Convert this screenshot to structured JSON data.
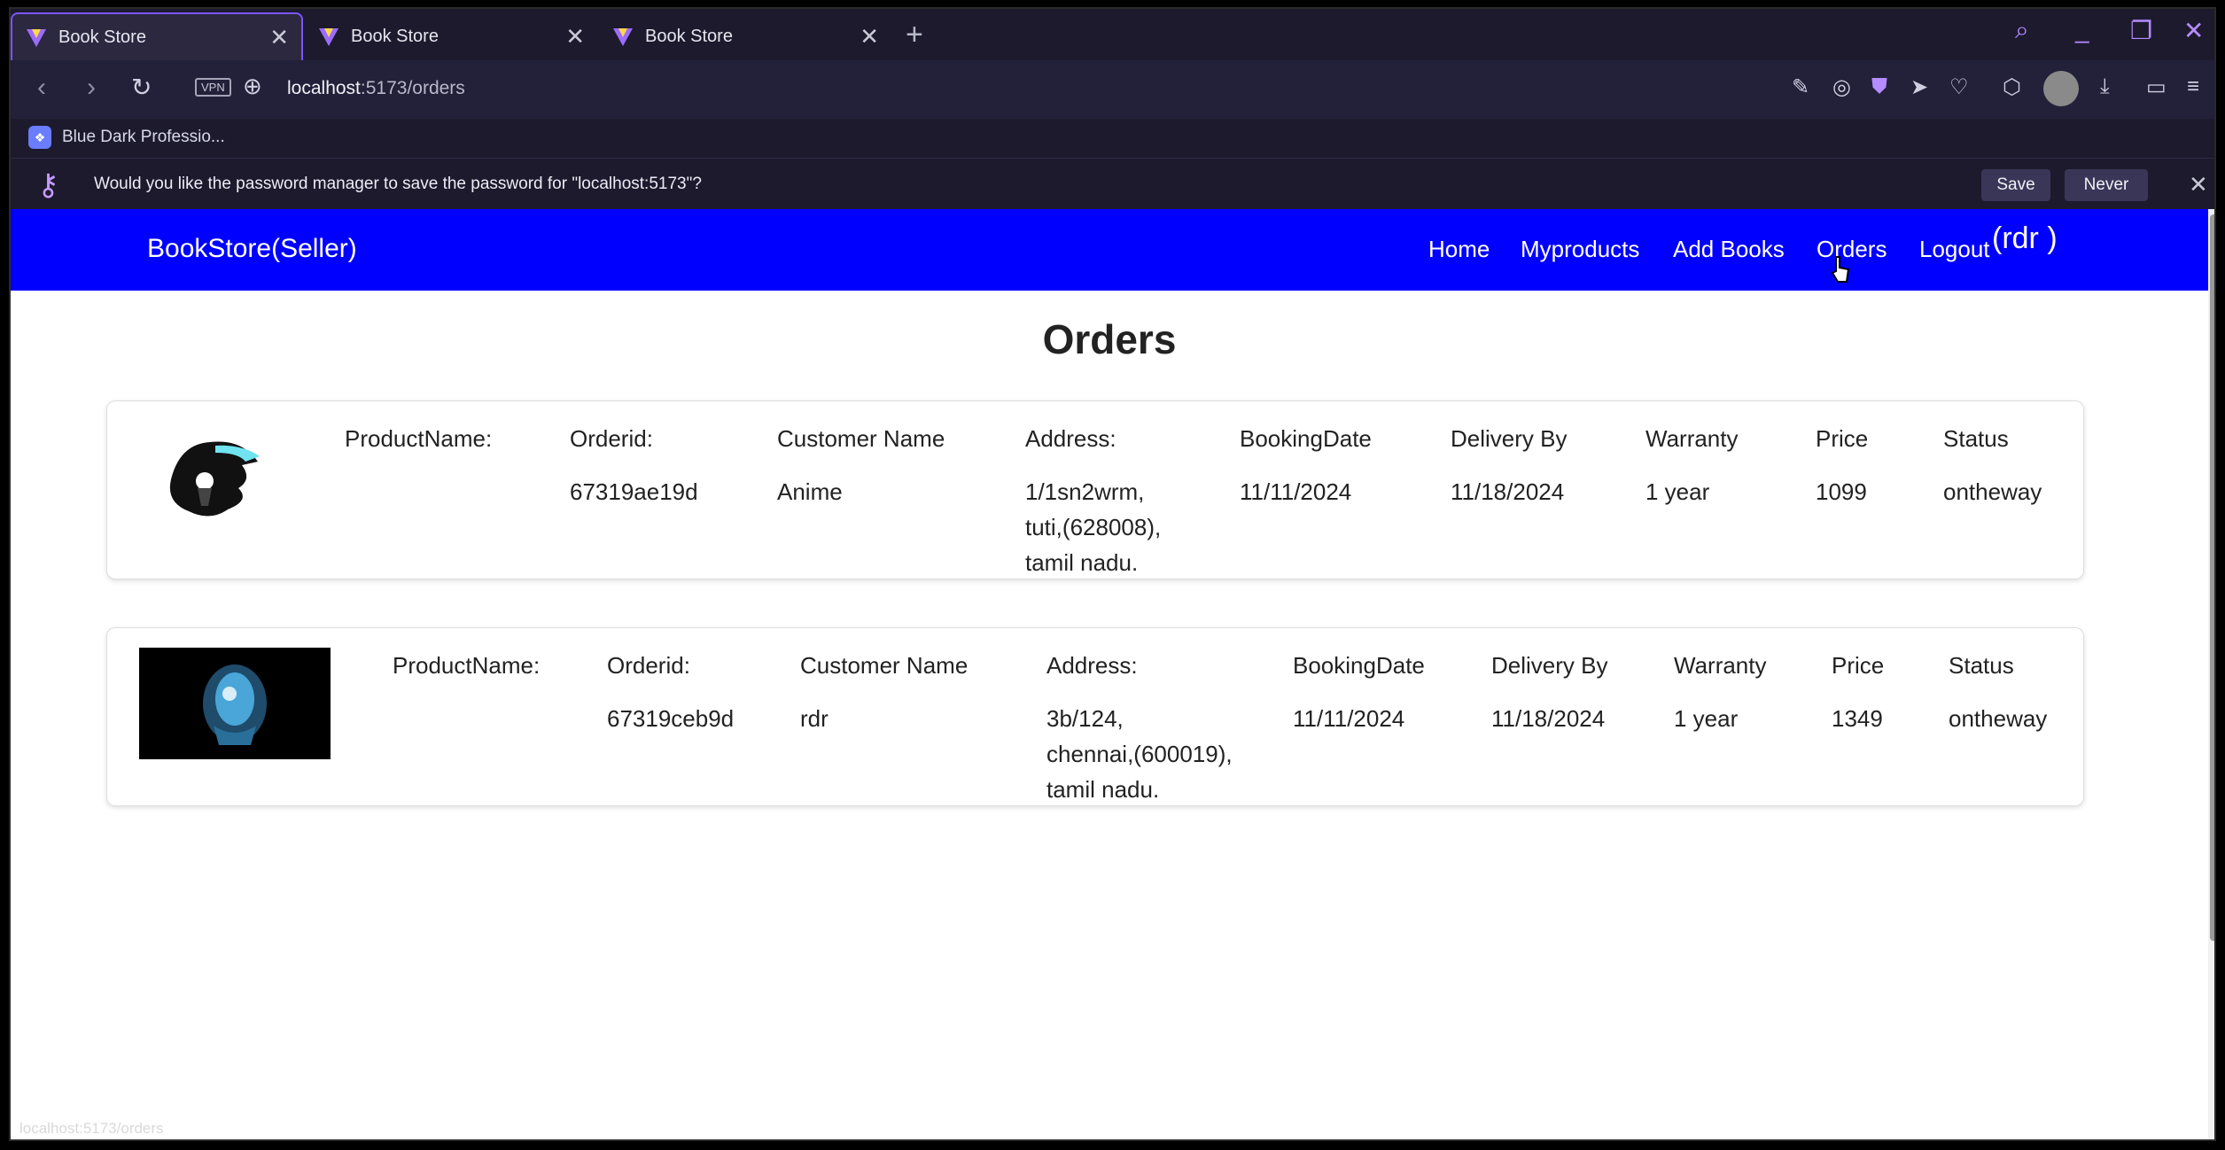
{
  "browser": {
    "tabs": [
      {
        "title": "Book Store",
        "active": true
      },
      {
        "title": "Book Store",
        "active": false
      },
      {
        "title": "Book Store",
        "active": false
      }
    ],
    "new_tab": "+",
    "address": {
      "host": "localhost",
      "rest": ":5173/orders"
    },
    "vpn_label": "VPN",
    "bookmark": "Blue Dark Professio...",
    "password_prompt": {
      "text": "Would you like the password manager to save the password for \"localhost:5173\"?",
      "save_label": "Save",
      "never_label": "Never"
    },
    "status_url": "localhost:5173/orders"
  },
  "navbar": {
    "brand": "BookStore(Seller)",
    "links": [
      "Home",
      "Myproducts",
      "Add Books",
      "Orders",
      "Logout"
    ],
    "user": "(rdr )"
  },
  "page": {
    "title": "Orders",
    "headers": {
      "product": "ProductName:",
      "orderid": "Orderid:",
      "customer": "Customer Name",
      "address": "Address:",
      "booking": "BookingDate",
      "delivery": "Delivery By",
      "warranty": "Warranty",
      "price": "Price",
      "status": "Status"
    },
    "orders": [
      {
        "orderid": "67319ae19d",
        "customer": "Anime",
        "address": [
          "1/1sn2wrm,",
          "tuti,(628008),",
          "tamil nadu."
        ],
        "booking": "11/11/2024",
        "delivery": "11/18/2024",
        "warranty": "1 year",
        "price": "1099",
        "status": "ontheway"
      },
      {
        "orderid": "67319ceb9d",
        "customer": "rdr",
        "address": [
          "3b/124,",
          "chennai,(600019),",
          "tamil nadu."
        ],
        "booking": "11/11/2024",
        "delivery": "11/18/2024",
        "warranty": "1 year",
        "price": "1349",
        "status": "ontheway"
      }
    ]
  },
  "colors": {
    "nav_blue": "#0000ff",
    "browser_dark": "#1d1a2e",
    "accent_purple": "#7a55ff"
  },
  "icons": [
    "back-icon",
    "forward-icon",
    "reload-icon",
    "globe-icon",
    "search-icon",
    "close-icon",
    "key-icon",
    "cursor-icon"
  ]
}
